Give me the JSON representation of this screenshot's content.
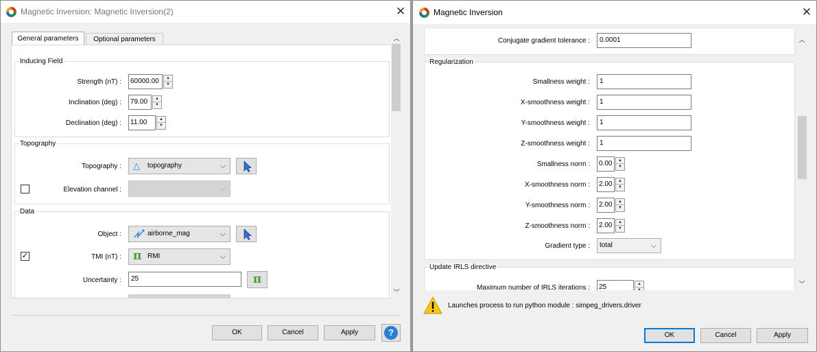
{
  "left_window": {
    "title": "Magnetic Inversion: Magnetic Inversion(2)",
    "tabs": [
      "General parameters",
      "Optional parameters"
    ],
    "inducing_field": {
      "title": "Inducing Field",
      "strength_label": "Strength (nT) :",
      "strength_value": "60000.00",
      "inclination_label": "Inclination (deg) :",
      "inclination_value": "79.00",
      "declination_label": "Declination (deg) :",
      "declination_value": "11.00"
    },
    "topography": {
      "title": "Topography",
      "topography_label": "Topography :",
      "topography_value": "topography",
      "elevation_label": "Elevation channel :"
    },
    "data": {
      "title": "Data",
      "object_label": "Object :",
      "object_value": "airborne_mag",
      "tmi_label": "TMI (nT) :",
      "tmi_value": "RMI",
      "uncertainty_label": "Uncertainty :",
      "uncertainty_value": "25"
    },
    "buttons": {
      "ok": "OK",
      "cancel": "Cancel",
      "apply": "Apply",
      "help": "?"
    }
  },
  "right_window": {
    "title": "Magnetic Inversion",
    "cg_tolerance_label": "Conjugate gradient tolerance :",
    "cg_tolerance_value": "0.0001",
    "regularization": {
      "title": "Regularization",
      "smallness_weight_label": "Smallness weight :",
      "smallness_weight_value": "1",
      "x_smooth_weight_label": "X-smoothness weight :",
      "x_smooth_weight_value": "1",
      "y_smooth_weight_label": "Y-smoothness weight :",
      "y_smooth_weight_value": "1",
      "z_smooth_weight_label": "Z-smoothness weight :",
      "z_smooth_weight_value": "1",
      "smallness_norm_label": "Smallness norm :",
      "smallness_norm_value": "0.00",
      "x_smooth_norm_label": "X-smoothness norm :",
      "x_smooth_norm_value": "2.00",
      "y_smooth_norm_label": "Y-smoothness norm :",
      "y_smooth_norm_value": "2.00",
      "z_smooth_norm_label": "Z-smoothness norm :",
      "z_smooth_norm_value": "2.00",
      "gradient_type_label": "Gradient type :",
      "gradient_type_value": "total"
    },
    "irls": {
      "title": "Update IRLS directive",
      "max_iter_label": "Maximum number of IRLS iterations :",
      "max_iter_value": "25"
    },
    "status_message": "Launches process to run python module : simpeg_drivers.driver",
    "buttons": {
      "ok": "OK",
      "cancel": "Cancel",
      "apply": "Apply"
    }
  },
  "colors": {
    "accent_blue": "#0078d7",
    "warning_yellow": "#f5c518",
    "pi_green": "#4e9a2e",
    "topo_blue": "#1e88e5"
  }
}
